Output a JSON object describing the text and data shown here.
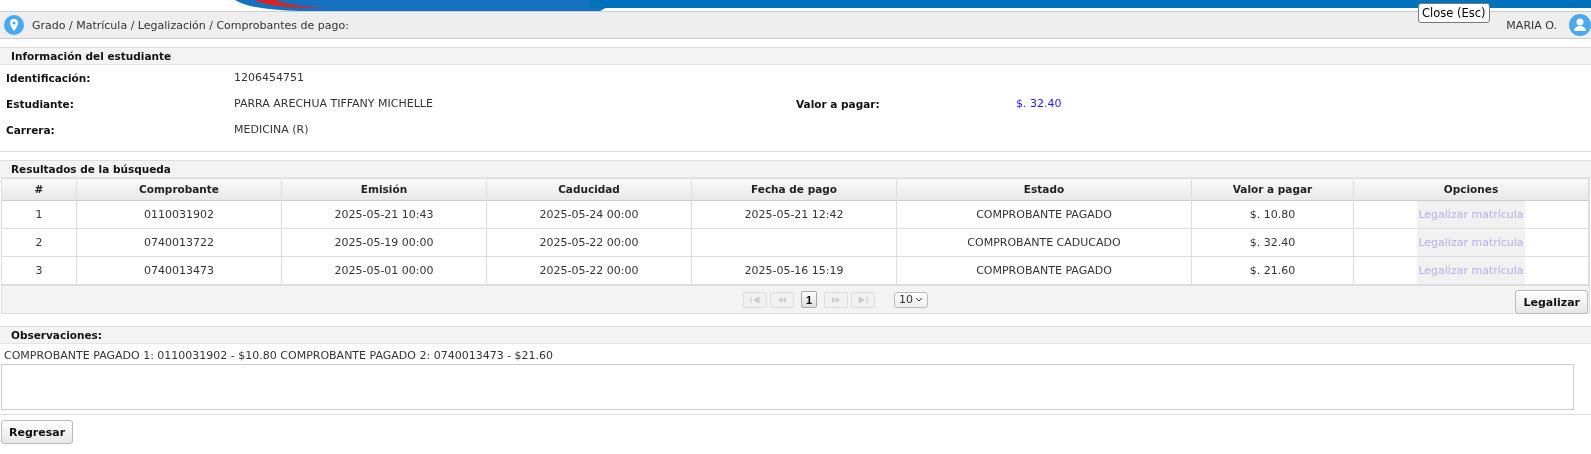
{
  "breadcrumb": "Grado / Matrícula / Legalización / Comprobantes de pago:",
  "user": {
    "name": "MARIA O."
  },
  "tooltip": "Close (Esc)",
  "student_info": {
    "title": "Información del estudiante",
    "fields": [
      {
        "label": "Identificación:",
        "value": "1206454751"
      },
      {
        "label": "Estudiante:",
        "value": "PARRA ARECHUA TIFFANY MICHELLE",
        "extra_label": "Valor a pagar:",
        "extra_value": "$. 32.40"
      },
      {
        "label": "Carrera:",
        "value": "MEDICINA (R)"
      }
    ]
  },
  "results": {
    "title": "Resultados de la búsqueda",
    "columns": [
      "#",
      "Comprobante",
      "Emisión",
      "Caducidad",
      "Fecha de pago",
      "Estado",
      "Valor a pagar",
      "Opciones"
    ],
    "rows": [
      {
        "n": "1",
        "comprobante": "0110031902",
        "emision": "2025-05-21 10:43",
        "caducidad": "2025-05-24 00:00",
        "fecha_pago": "2025-05-21 12:42",
        "estado": "COMPROBANTE PAGADO",
        "valor": "$. 10.80",
        "opcion": "Legalizar matrícula",
        "disabled": true
      },
      {
        "n": "2",
        "comprobante": "0740013722",
        "emision": "2025-05-19 00:00",
        "caducidad": "2025-05-22 00:00",
        "fecha_pago": "",
        "estado": "COMPROBANTE CADUCADO",
        "valor": "$. 32.40",
        "opcion": "Legalizar matrícula",
        "disabled": true
      },
      {
        "n": "3",
        "comprobante": "0740013473",
        "emision": "2025-05-01 00:00",
        "caducidad": "2025-05-22 00:00",
        "fecha_pago": "2025-05-16 15:19",
        "estado": "COMPROBANTE PAGADO",
        "valor": "$. 21.60",
        "opcion": "Legalizar matrícula",
        "disabled": true
      }
    ],
    "pager": {
      "page": "1",
      "page_size": "10"
    },
    "action": "Legalizar"
  },
  "observations": {
    "title": "Observaciones:",
    "text": "COMPROBANTE PAGADO 1: 0110031902 - $10.80 COMPROBANTE PAGADO 2: 0740013473 - $21.60"
  },
  "back_button": "Regresar"
}
